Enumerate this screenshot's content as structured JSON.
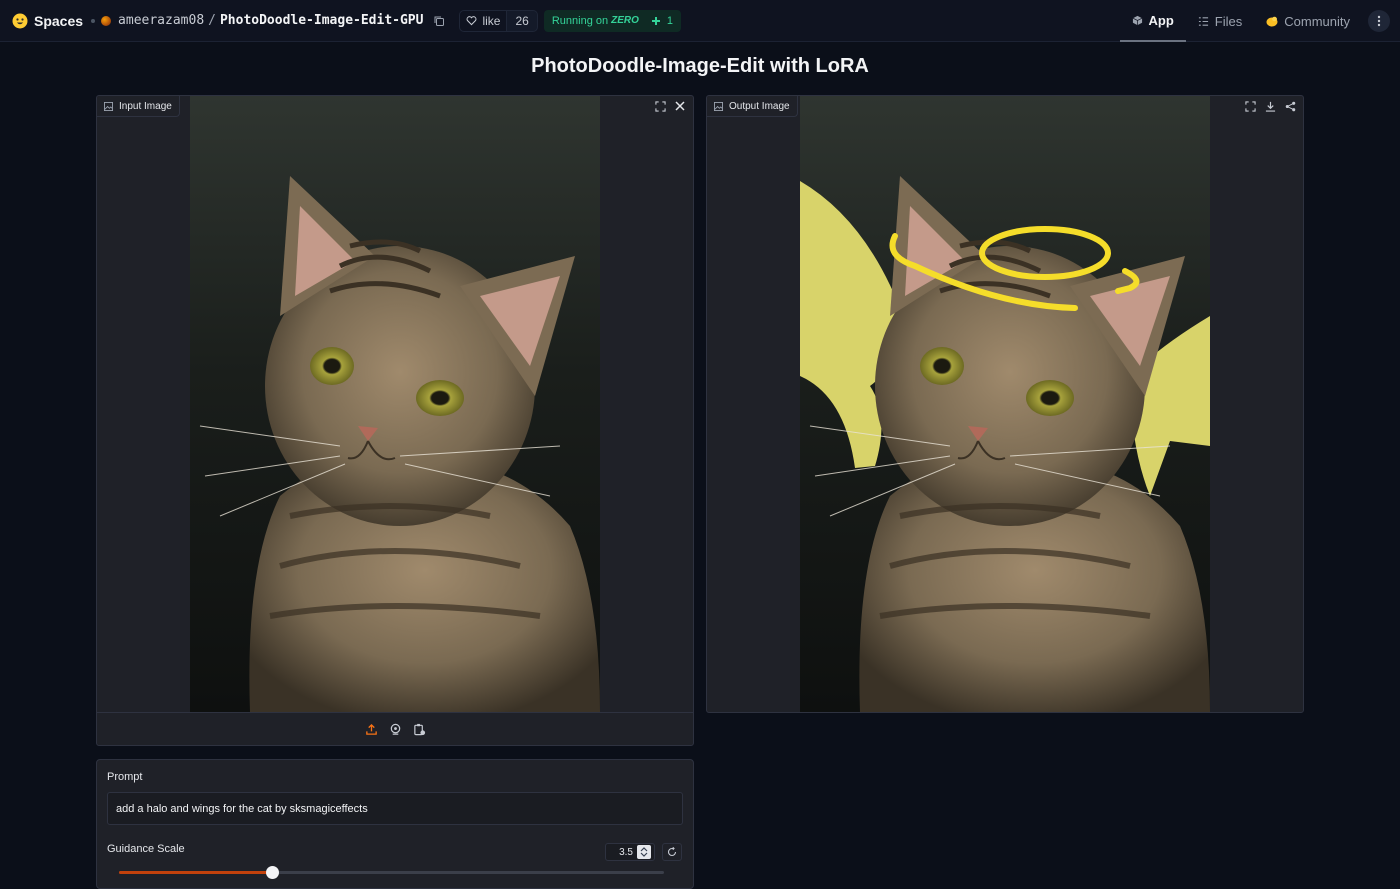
{
  "header": {
    "brand": "Spaces",
    "repo_owner": "ameerazam08",
    "repo_slash": "/",
    "repo_name": "PhotoDoodle-Image-Edit-GPU",
    "like_label": "like",
    "like_count": "26",
    "status_running": "Running on",
    "status_hardware": "ZERO",
    "status_count": "1",
    "nav": {
      "app": "App",
      "files": "Files",
      "community": "Community"
    }
  },
  "page": {
    "title": "PhotoDoodle-Image-Edit with LoRA"
  },
  "input_panel": {
    "label": "Input Image"
  },
  "output_panel": {
    "label": "Output Image"
  },
  "form": {
    "prompt_label": "Prompt",
    "prompt_value": "add a halo and wings for the cat by sksmagiceffects",
    "guidance_label": "Guidance Scale",
    "guidance_value": "3.5",
    "guidance_fraction": 0.28
  },
  "colors": {
    "accent": "#c2410c",
    "running": "#34d399",
    "halo": "#f5dd2a",
    "wings": "#d8d36a"
  }
}
